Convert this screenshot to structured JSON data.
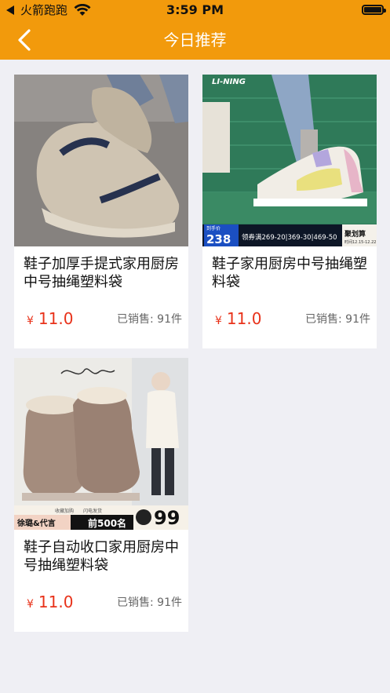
{
  "status_bar": {
    "carrier": "火箭跑跑",
    "time": "3:59 PM"
  },
  "nav": {
    "title": "今日推荐",
    "back_icon": "chevron-left-icon"
  },
  "products": [
    {
      "title": "鞋子加厚手提式家用厨房中号抽绳塑料袋",
      "currency": "¥",
      "price": "11.0",
      "sales": "已销售: 91件"
    },
    {
      "title": "鞋子家用厨房中号抽绳塑料袋",
      "currency": "¥",
      "price": "11.0",
      "sales": "已销售: 91件",
      "image_text": {
        "brand": "LI-NING",
        "price_tag": "到手价",
        "price": "238",
        "coupons": "领券满269-20|369-30|469-50",
        "badge": "聚划算",
        "dates": "时间12.15-12.22"
      }
    },
    {
      "title": "鞋子自动收口家用厨房中号抽绳塑料袋",
      "currency": "¥",
      "price": "11.0",
      "sales": "已销售: 91件",
      "image_text": {
        "store": "徐璐&代言",
        "tag1": "收藏加购",
        "tag2": "闪电发货",
        "rank": "前500名",
        "price": "99"
      }
    }
  ],
  "colors": {
    "accent": "#f29a0c",
    "price": "#e8321a",
    "background": "#efeff4"
  }
}
